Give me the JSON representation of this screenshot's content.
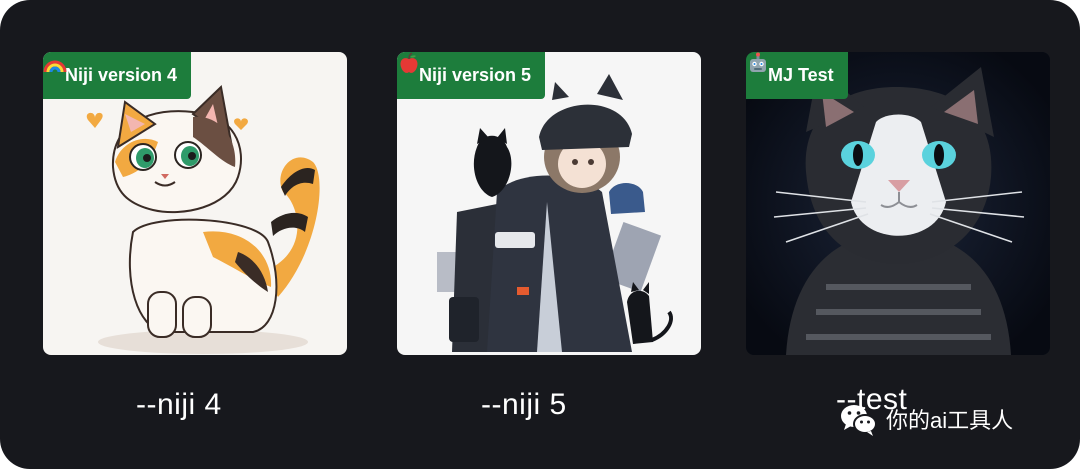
{
  "cards": [
    {
      "badge_icon": "rainbow-icon",
      "badge_label": "Niji version 4",
      "caption": "--niji 4",
      "image": "illustrated calico cat"
    },
    {
      "badge_icon": "apple-icon",
      "badge_label": "Niji version 5",
      "caption": "--niji 5",
      "image": "anime girl with black cats"
    },
    {
      "badge_icon": "robot-icon",
      "badge_label": "MJ Test",
      "caption": "--test",
      "image": "realistic black and white cat"
    }
  ],
  "watermark": {
    "icon": "wechat-icon",
    "text": "你的ai工具人"
  },
  "colors": {
    "background": "#17181d",
    "badge": "#1d7d3c",
    "text": "#ffffff"
  }
}
